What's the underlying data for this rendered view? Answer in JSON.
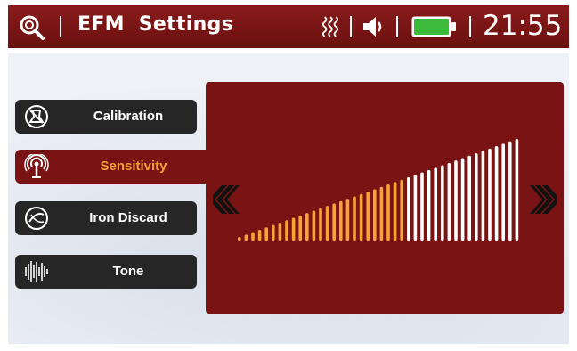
{
  "header": {
    "title": "EFM  Settings",
    "clock": "21:55",
    "icons": [
      "search-icon",
      "heat-icon",
      "speaker-icon",
      "battery-icon"
    ],
    "battery_color": "#3cba3c"
  },
  "menu": {
    "items": [
      {
        "label": "Calibration",
        "icon": "calibration-icon",
        "active": false
      },
      {
        "label": "Sensitivity",
        "icon": "antenna-icon",
        "active": true
      },
      {
        "label": "Iron Discard",
        "icon": "iron-discard-icon",
        "active": false
      },
      {
        "label": "Tone",
        "icon": "waveform-icon",
        "active": false
      }
    ]
  },
  "sensitivity": {
    "level": 25,
    "max": 42,
    "active_color": "#f7a33a",
    "inactive_color": "#ffffff",
    "decrease_icon": "decrease-arrow-icon",
    "increase_icon": "increase-arrow-icon"
  },
  "colors": {
    "accent": "#7a1313",
    "highlight": "#f2a13d"
  }
}
